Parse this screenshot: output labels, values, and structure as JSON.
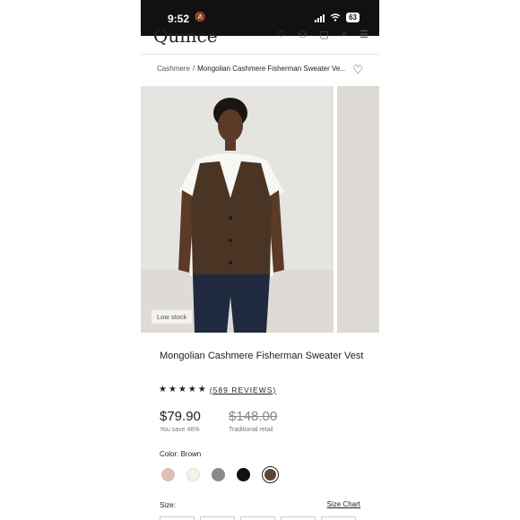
{
  "status_bar": {
    "time": "9:52",
    "battery": "63"
  },
  "header": {
    "logo": "Quince"
  },
  "breadcrumb": {
    "parent": "Cashmere",
    "separator": "/",
    "current": "Mongolian Cashmere Fisherman Sweater Ve..."
  },
  "gallery": {
    "badge": "Low stock"
  },
  "product": {
    "title": "Mongolian Cashmere Fisherman Sweater Vest",
    "rating_stars": 5,
    "reviews": "(589 REVIEWS)",
    "price": "$79.90",
    "savings": "You save 46%",
    "original_price": "$148.00",
    "retail_label": "Traditional retail",
    "color_label": "Color: Brown",
    "colors": [
      "#dcbfb5",
      "#f6f1e6",
      "#8a8a8a",
      "#111111",
      "#5d4535"
    ],
    "selected_color_index": 4,
    "size_label": "Size:",
    "size_chart": "Size Chart"
  }
}
